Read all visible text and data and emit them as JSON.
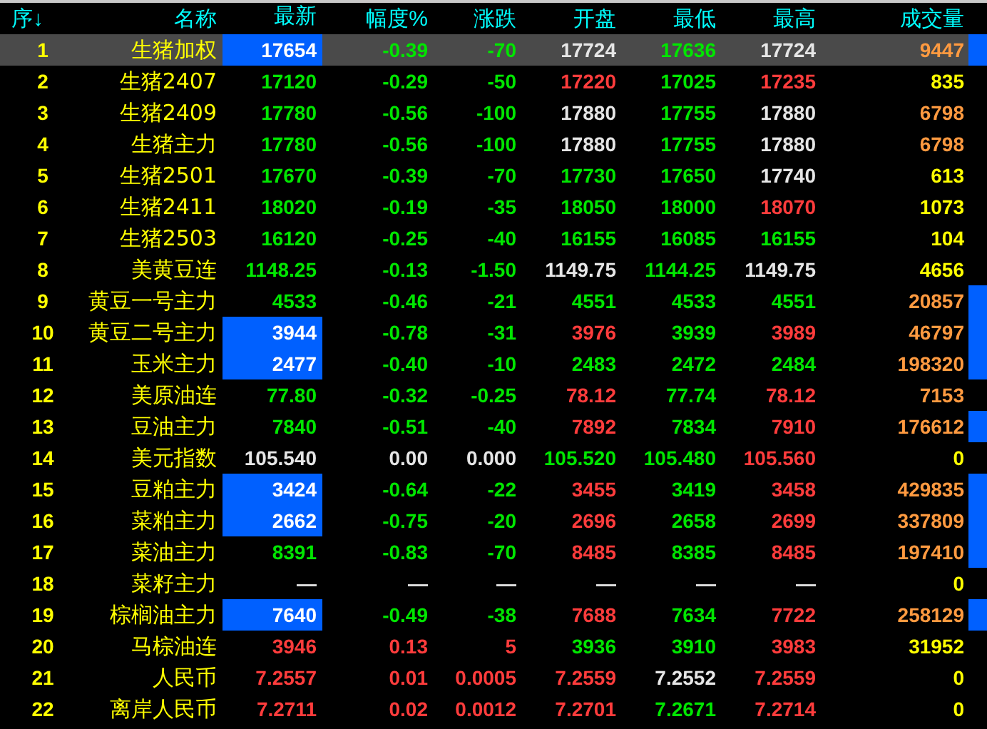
{
  "header": [
    "序↓",
    "名称",
    "最新",
    "幅度%",
    "涨跌",
    "开盘",
    "最低",
    "最高",
    "成交量"
  ],
  "rows": [
    {
      "seq": "1",
      "name": "生猪加权",
      "selected": true,
      "highlighted": true,
      "marked": true,
      "cells": [
        {
          "text": "17654"
        },
        {
          "text": "-0.39",
          "kind": "down"
        },
        {
          "text": "-70",
          "kind": "down"
        },
        {
          "text": "17724",
          "kind": "flat"
        },
        {
          "text": "17636",
          "kind": "down"
        },
        {
          "text": "17724",
          "kind": "flat"
        }
      ],
      "volume": {
        "text": "9447",
        "kind": "heavy"
      }
    },
    {
      "seq": "2",
      "name": "生猪2407",
      "selected": false,
      "highlighted": false,
      "marked": false,
      "cells": [
        {
          "text": "17120",
          "kind": "down"
        },
        {
          "text": "-0.29",
          "kind": "down"
        },
        {
          "text": "-50",
          "kind": "down"
        },
        {
          "text": "17220",
          "kind": "up"
        },
        {
          "text": "17025",
          "kind": "down"
        },
        {
          "text": "17235",
          "kind": "up"
        }
      ],
      "volume": {
        "text": "835",
        "kind": "light"
      }
    },
    {
      "seq": "3",
      "name": "生猪2409",
      "selected": false,
      "highlighted": false,
      "marked": false,
      "cells": [
        {
          "text": "17780",
          "kind": "down"
        },
        {
          "text": "-0.56",
          "kind": "down"
        },
        {
          "text": "-100",
          "kind": "down"
        },
        {
          "text": "17880",
          "kind": "flat"
        },
        {
          "text": "17755",
          "kind": "down"
        },
        {
          "text": "17880",
          "kind": "flat"
        }
      ],
      "volume": {
        "text": "6798",
        "kind": "heavy"
      }
    },
    {
      "seq": "4",
      "name": "生猪主力",
      "selected": false,
      "highlighted": false,
      "marked": false,
      "cells": [
        {
          "text": "17780",
          "kind": "down"
        },
        {
          "text": "-0.56",
          "kind": "down"
        },
        {
          "text": "-100",
          "kind": "down"
        },
        {
          "text": "17880",
          "kind": "flat"
        },
        {
          "text": "17755",
          "kind": "down"
        },
        {
          "text": "17880",
          "kind": "flat"
        }
      ],
      "volume": {
        "text": "6798",
        "kind": "heavy"
      }
    },
    {
      "seq": "5",
      "name": "生猪2501",
      "selected": false,
      "highlighted": false,
      "marked": false,
      "cells": [
        {
          "text": "17670",
          "kind": "down"
        },
        {
          "text": "-0.39",
          "kind": "down"
        },
        {
          "text": "-70",
          "kind": "down"
        },
        {
          "text": "17730",
          "kind": "down"
        },
        {
          "text": "17650",
          "kind": "down"
        },
        {
          "text": "17740",
          "kind": "flat"
        }
      ],
      "volume": {
        "text": "613",
        "kind": "light"
      }
    },
    {
      "seq": "6",
      "name": "生猪2411",
      "selected": false,
      "highlighted": false,
      "marked": false,
      "cells": [
        {
          "text": "18020",
          "kind": "down"
        },
        {
          "text": "-0.19",
          "kind": "down"
        },
        {
          "text": "-35",
          "kind": "down"
        },
        {
          "text": "18050",
          "kind": "down"
        },
        {
          "text": "18000",
          "kind": "down"
        },
        {
          "text": "18070",
          "kind": "up"
        }
      ],
      "volume": {
        "text": "1073",
        "kind": "light"
      }
    },
    {
      "seq": "7",
      "name": "生猪2503",
      "selected": false,
      "highlighted": false,
      "marked": false,
      "cells": [
        {
          "text": "16120",
          "kind": "down"
        },
        {
          "text": "-0.25",
          "kind": "down"
        },
        {
          "text": "-40",
          "kind": "down"
        },
        {
          "text": "16155",
          "kind": "down"
        },
        {
          "text": "16085",
          "kind": "down"
        },
        {
          "text": "16155",
          "kind": "down"
        }
      ],
      "volume": {
        "text": "104",
        "kind": "light"
      }
    },
    {
      "seq": "8",
      "name": "美黄豆连",
      "selected": false,
      "highlighted": false,
      "marked": false,
      "cells": [
        {
          "text": "1148.25",
          "kind": "down"
        },
        {
          "text": "-0.13",
          "kind": "down"
        },
        {
          "text": "-1.50",
          "kind": "down"
        },
        {
          "text": "1149.75",
          "kind": "flat"
        },
        {
          "text": "1144.25",
          "kind": "down"
        },
        {
          "text": "1149.75",
          "kind": "flat"
        }
      ],
      "volume": {
        "text": "4656",
        "kind": "light"
      }
    },
    {
      "seq": "9",
      "name": "黄豆一号主力",
      "selected": false,
      "highlighted": false,
      "marked": true,
      "cells": [
        {
          "text": "4533",
          "kind": "down"
        },
        {
          "text": "-0.46",
          "kind": "down"
        },
        {
          "text": "-21",
          "kind": "down"
        },
        {
          "text": "4551",
          "kind": "down"
        },
        {
          "text": "4533",
          "kind": "down"
        },
        {
          "text": "4551",
          "kind": "down"
        }
      ],
      "volume": {
        "text": "20857",
        "kind": "heavy"
      }
    },
    {
      "seq": "10",
      "name": "黄豆二号主力",
      "selected": false,
      "highlighted": true,
      "marked": true,
      "cells": [
        {
          "text": "3944"
        },
        {
          "text": "-0.78",
          "kind": "down"
        },
        {
          "text": "-31",
          "kind": "down"
        },
        {
          "text": "3976",
          "kind": "up"
        },
        {
          "text": "3939",
          "kind": "down"
        },
        {
          "text": "3989",
          "kind": "up"
        }
      ],
      "volume": {
        "text": "46797",
        "kind": "heavy"
      }
    },
    {
      "seq": "11",
      "name": "玉米主力",
      "selected": false,
      "highlighted": true,
      "marked": true,
      "cells": [
        {
          "text": "2477"
        },
        {
          "text": "-0.40",
          "kind": "down"
        },
        {
          "text": "-10",
          "kind": "down"
        },
        {
          "text": "2483",
          "kind": "down"
        },
        {
          "text": "2472",
          "kind": "down"
        },
        {
          "text": "2484",
          "kind": "down"
        }
      ],
      "volume": {
        "text": "198320",
        "kind": "heavy"
      }
    },
    {
      "seq": "12",
      "name": "美原油连",
      "selected": false,
      "highlighted": false,
      "marked": false,
      "cells": [
        {
          "text": "77.80",
          "kind": "down"
        },
        {
          "text": "-0.32",
          "kind": "down"
        },
        {
          "text": "-0.25",
          "kind": "down"
        },
        {
          "text": "78.12",
          "kind": "up"
        },
        {
          "text": "77.74",
          "kind": "down"
        },
        {
          "text": "78.12",
          "kind": "up"
        }
      ],
      "volume": {
        "text": "7153",
        "kind": "heavy"
      }
    },
    {
      "seq": "13",
      "name": "豆油主力",
      "selected": false,
      "highlighted": false,
      "marked": true,
      "cells": [
        {
          "text": "7840",
          "kind": "down"
        },
        {
          "text": "-0.51",
          "kind": "down"
        },
        {
          "text": "-40",
          "kind": "down"
        },
        {
          "text": "7892",
          "kind": "up"
        },
        {
          "text": "7834",
          "kind": "down"
        },
        {
          "text": "7910",
          "kind": "up"
        }
      ],
      "volume": {
        "text": "176612",
        "kind": "heavy"
      }
    },
    {
      "seq": "14",
      "name": "美元指数",
      "selected": false,
      "highlighted": false,
      "marked": false,
      "cells": [
        {
          "text": "105.540",
          "kind": "flat"
        },
        {
          "text": "0.00",
          "kind": "flat"
        },
        {
          "text": "0.000",
          "kind": "flat"
        },
        {
          "text": "105.520",
          "kind": "down"
        },
        {
          "text": "105.480",
          "kind": "down"
        },
        {
          "text": "105.560",
          "kind": "up"
        }
      ],
      "volume": {
        "text": "0",
        "kind": "light"
      }
    },
    {
      "seq": "15",
      "name": "豆粕主力",
      "selected": false,
      "highlighted": true,
      "marked": true,
      "cells": [
        {
          "text": "3424"
        },
        {
          "text": "-0.64",
          "kind": "down"
        },
        {
          "text": "-22",
          "kind": "down"
        },
        {
          "text": "3455",
          "kind": "up"
        },
        {
          "text": "3419",
          "kind": "down"
        },
        {
          "text": "3458",
          "kind": "up"
        }
      ],
      "volume": {
        "text": "429835",
        "kind": "heavy"
      }
    },
    {
      "seq": "16",
      "name": "菜粕主力",
      "selected": false,
      "highlighted": true,
      "marked": true,
      "cells": [
        {
          "text": "2662"
        },
        {
          "text": "-0.75",
          "kind": "down"
        },
        {
          "text": "-20",
          "kind": "down"
        },
        {
          "text": "2696",
          "kind": "up"
        },
        {
          "text": "2658",
          "kind": "down"
        },
        {
          "text": "2699",
          "kind": "up"
        }
      ],
      "volume": {
        "text": "337809",
        "kind": "heavy"
      }
    },
    {
      "seq": "17",
      "name": "菜油主力",
      "selected": false,
      "highlighted": false,
      "marked": true,
      "cells": [
        {
          "text": "8391",
          "kind": "down"
        },
        {
          "text": "-0.83",
          "kind": "down"
        },
        {
          "text": "-70",
          "kind": "down"
        },
        {
          "text": "8485",
          "kind": "up"
        },
        {
          "text": "8385",
          "kind": "down"
        },
        {
          "text": "8485",
          "kind": "up"
        }
      ],
      "volume": {
        "text": "197410",
        "kind": "heavy"
      }
    },
    {
      "seq": "18",
      "name": "菜籽主力",
      "selected": false,
      "highlighted": false,
      "marked": false,
      "cells": [
        {
          "text": "—",
          "kind": "flat"
        },
        {
          "text": "—",
          "kind": "flat"
        },
        {
          "text": "—",
          "kind": "flat"
        },
        {
          "text": "—",
          "kind": "flat"
        },
        {
          "text": "—",
          "kind": "flat"
        },
        {
          "text": "—",
          "kind": "flat"
        }
      ],
      "volume": {
        "text": "0",
        "kind": "light"
      }
    },
    {
      "seq": "19",
      "name": "棕榈油主力",
      "selected": false,
      "highlighted": true,
      "marked": true,
      "cells": [
        {
          "text": "7640"
        },
        {
          "text": "-0.49",
          "kind": "down"
        },
        {
          "text": "-38",
          "kind": "down"
        },
        {
          "text": "7688",
          "kind": "up"
        },
        {
          "text": "7634",
          "kind": "down"
        },
        {
          "text": "7722",
          "kind": "up"
        }
      ],
      "volume": {
        "text": "258129",
        "kind": "heavy"
      }
    },
    {
      "seq": "20",
      "name": "马棕油连",
      "selected": false,
      "highlighted": false,
      "marked": false,
      "cells": [
        {
          "text": "3946",
          "kind": "up"
        },
        {
          "text": "0.13",
          "kind": "up"
        },
        {
          "text": "5",
          "kind": "up"
        },
        {
          "text": "3936",
          "kind": "down"
        },
        {
          "text": "3910",
          "kind": "down"
        },
        {
          "text": "3983",
          "kind": "up"
        }
      ],
      "volume": {
        "text": "31952",
        "kind": "light"
      }
    },
    {
      "seq": "21",
      "name": "人民币",
      "selected": false,
      "highlighted": false,
      "marked": false,
      "cells": [
        {
          "text": "7.2557",
          "kind": "up"
        },
        {
          "text": "0.01",
          "kind": "up"
        },
        {
          "text": "0.0005",
          "kind": "up"
        },
        {
          "text": "7.2559",
          "kind": "up"
        },
        {
          "text": "7.2552",
          "kind": "flat"
        },
        {
          "text": "7.2559",
          "kind": "up"
        }
      ],
      "volume": {
        "text": "0",
        "kind": "light"
      }
    },
    {
      "seq": "22",
      "name": "离岸人民币",
      "selected": false,
      "highlighted": false,
      "marked": false,
      "cells": [
        {
          "text": "7.2711",
          "kind": "up"
        },
        {
          "text": "0.02",
          "kind": "up"
        },
        {
          "text": "0.0012",
          "kind": "up"
        },
        {
          "text": "7.2701",
          "kind": "up"
        },
        {
          "text": "7.2671",
          "kind": "down"
        },
        {
          "text": "7.2714",
          "kind": "up"
        }
      ],
      "volume": {
        "text": "0",
        "kind": "light"
      }
    }
  ]
}
